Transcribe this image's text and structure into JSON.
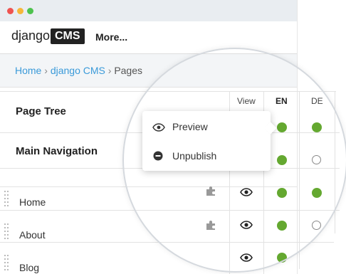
{
  "window": {
    "traffic_lights": [
      "#ef5350",
      "#f6b739",
      "#4ec24e"
    ]
  },
  "toolbar": {
    "logo_text": "django",
    "logo_box": "CMS",
    "more_label": "More..."
  },
  "breadcrumb": {
    "home": "Home",
    "section": "django CMS",
    "current": "Pages",
    "separator": "›"
  },
  "page_tree": {
    "title": "Page Tree",
    "nav_title": "Main Navigation"
  },
  "columns": {
    "view": "View",
    "en": "EN",
    "de": "DE"
  },
  "pages": [
    {
      "title": "Home",
      "en": "published",
      "de": "published"
    },
    {
      "title": "About",
      "en": "published",
      "de": "unpublished"
    },
    {
      "title": "Blog",
      "en": "published",
      "de": ""
    }
  ],
  "popup": {
    "preview_label": "Preview",
    "unpublish_label": "Unpublish"
  },
  "colors": {
    "published": "#64a830",
    "link": "#3a9ad9"
  }
}
